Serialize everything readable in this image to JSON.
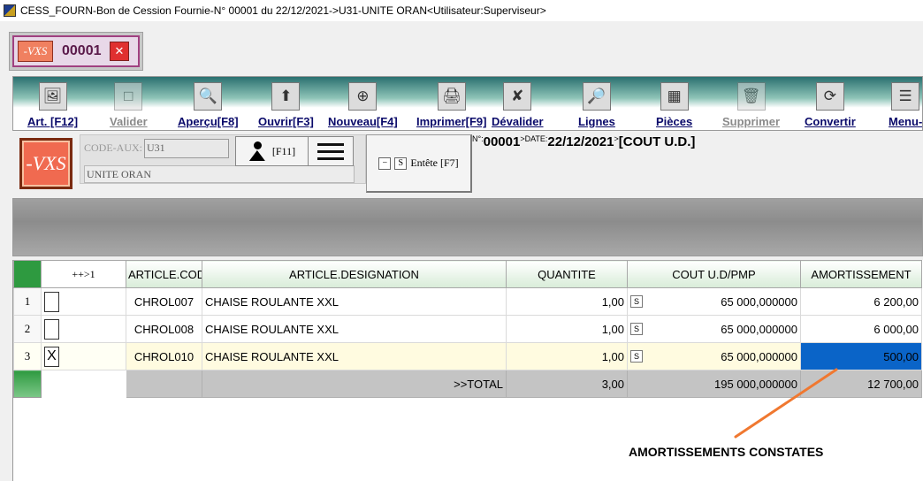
{
  "window": {
    "title": "CESS_FOURN-Bon de Cession Fournie-N° 00001 du 22/12/2021->U31-UNITE ORAN<Utilisateur:Superviseur>"
  },
  "doc_tab": {
    "logo_text": "-VXS",
    "number": "00001",
    "close": "✕"
  },
  "toolbar": {
    "buttons": [
      {
        "label": "Art. [F12]",
        "icon": "🖼",
        "enabled": true
      },
      {
        "label": "Valider",
        "icon": "□",
        "enabled": false
      },
      {
        "label": "Aperçu[F8]",
        "icon": "🔍",
        "enabled": true
      },
      {
        "label": "Ouvrir[F3]",
        "icon": "⬆",
        "enabled": true
      },
      {
        "label": "Nouveau[F4]",
        "icon": "⊕",
        "enabled": true
      },
      {
        "label": "Imprimer[F9]",
        "icon": "🖨",
        "enabled": true
      },
      {
        "label": "Dévalider",
        "icon": "✘",
        "enabled": true
      },
      {
        "label": "Lignes",
        "icon": "🔎",
        "enabled": true
      },
      {
        "label": "Pièces",
        "icon": "▦",
        "enabled": true
      },
      {
        "label": "Supprimer",
        "icon": "🗑",
        "enabled": false
      },
      {
        "label": "Convertir",
        "icon": "⟳",
        "enabled": true
      },
      {
        "label": "Menu-",
        "icon": "☰",
        "enabled": true
      }
    ]
  },
  "info": {
    "logo_text": "-VXS",
    "code_aux_label": "CODE-AUX:",
    "code_aux_value": "U31",
    "aux_name": "UNITE ORAN",
    "f11_label": "[F11]",
    "entete_minus": "−",
    "entete_s": "S",
    "entete_label": "Entête [F7]",
    "header": {
      "n_label": "N°:",
      "number": "00001",
      "date_label": ">DATE:",
      "date": "22/12/2021",
      "sep": ">",
      "type": "[COUT U.D.]"
    }
  },
  "grid": {
    "columns": [
      "++>1",
      "ARTICLE.COD",
      "ARTICLE.DESIGNATION",
      "QUANTITE",
      "COUT U.D/PMP",
      "AMORTISSEMENT"
    ],
    "s_label": "S",
    "rows": [
      {
        "num": "1",
        "check": "",
        "code": "CHROL007",
        "designation": "CHAISE ROULANTE XXL",
        "quantite": "1,00",
        "cout": "65 000,000000",
        "amortissement": "6 200,00"
      },
      {
        "num": "2",
        "check": "",
        "code": "CHROL008",
        "designation": "CHAISE ROULANTE XXL",
        "quantite": "1,00",
        "cout": "65 000,000000",
        "amortissement": "6 000,00"
      },
      {
        "num": "3",
        "check": "X",
        "code": "CHROL010",
        "designation": "CHAISE ROULANTE XXL",
        "quantite": "1,00",
        "cout": "65 000,000000",
        "amortissement": "500,00"
      }
    ],
    "total": {
      "label": ">>TOTAL",
      "quantite": "3,00",
      "cout": "195 000,000000",
      "amortissement": "12 700,00"
    }
  },
  "annotation": {
    "text": "AMORTISSEMENTS CONSTATES",
    "color": "#f07830"
  }
}
